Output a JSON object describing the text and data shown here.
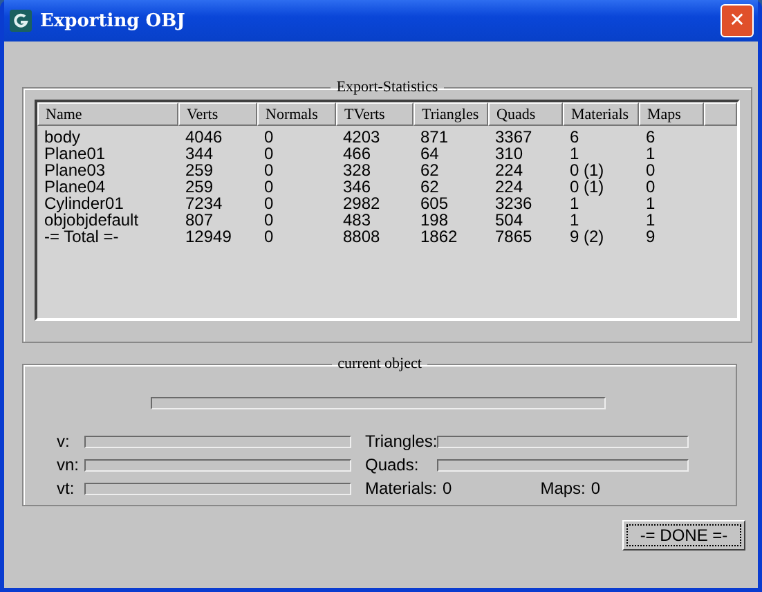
{
  "window": {
    "title": "Exporting OBJ",
    "close": "✕"
  },
  "statistics": {
    "title": "Export-Statistics",
    "columns": [
      "Name",
      "Verts",
      "Normals",
      "TVerts",
      "Triangles",
      "Quads",
      "Materials",
      "Maps"
    ],
    "rows": [
      [
        "body",
        "4046",
        "0",
        "4203",
        "871",
        "3367",
        "6",
        "6"
      ],
      [
        "Plane01",
        "344",
        "0",
        "466",
        "64",
        "310",
        "1",
        "1"
      ],
      [
        "Plane03",
        "259",
        "0",
        "328",
        "62",
        "224",
        "0 (1)",
        "0"
      ],
      [
        "Plane04",
        "259",
        "0",
        "346",
        "62",
        "224",
        "0 (1)",
        "0"
      ],
      [
        "Cylinder01",
        "7234",
        "0",
        "2982",
        "605",
        "3236",
        "1",
        "1"
      ],
      [
        "objobjdefault",
        "807",
        "0",
        "483",
        "198",
        "504",
        "1",
        "1"
      ],
      [
        "-= Total =-",
        "12949",
        "0",
        "8808",
        "1862",
        "7865",
        "9 (2)",
        "9"
      ]
    ]
  },
  "current_object": {
    "title": "current object",
    "overall_progress": {
      "level": 0
    },
    "left": [
      {
        "label": "v:",
        "level": 0
      },
      {
        "label": "vn:",
        "level": 0
      },
      {
        "label": "vt:",
        "level": 0
      }
    ],
    "right": [
      {
        "label": "Triangles:",
        "level": 0
      },
      {
        "label": "Quads:",
        "level": 0
      }
    ],
    "materials": {
      "label": "Materials:",
      "value": "0"
    },
    "maps": {
      "label": "Maps:",
      "value": "0"
    }
  },
  "done_button": "-= DONE =-"
}
